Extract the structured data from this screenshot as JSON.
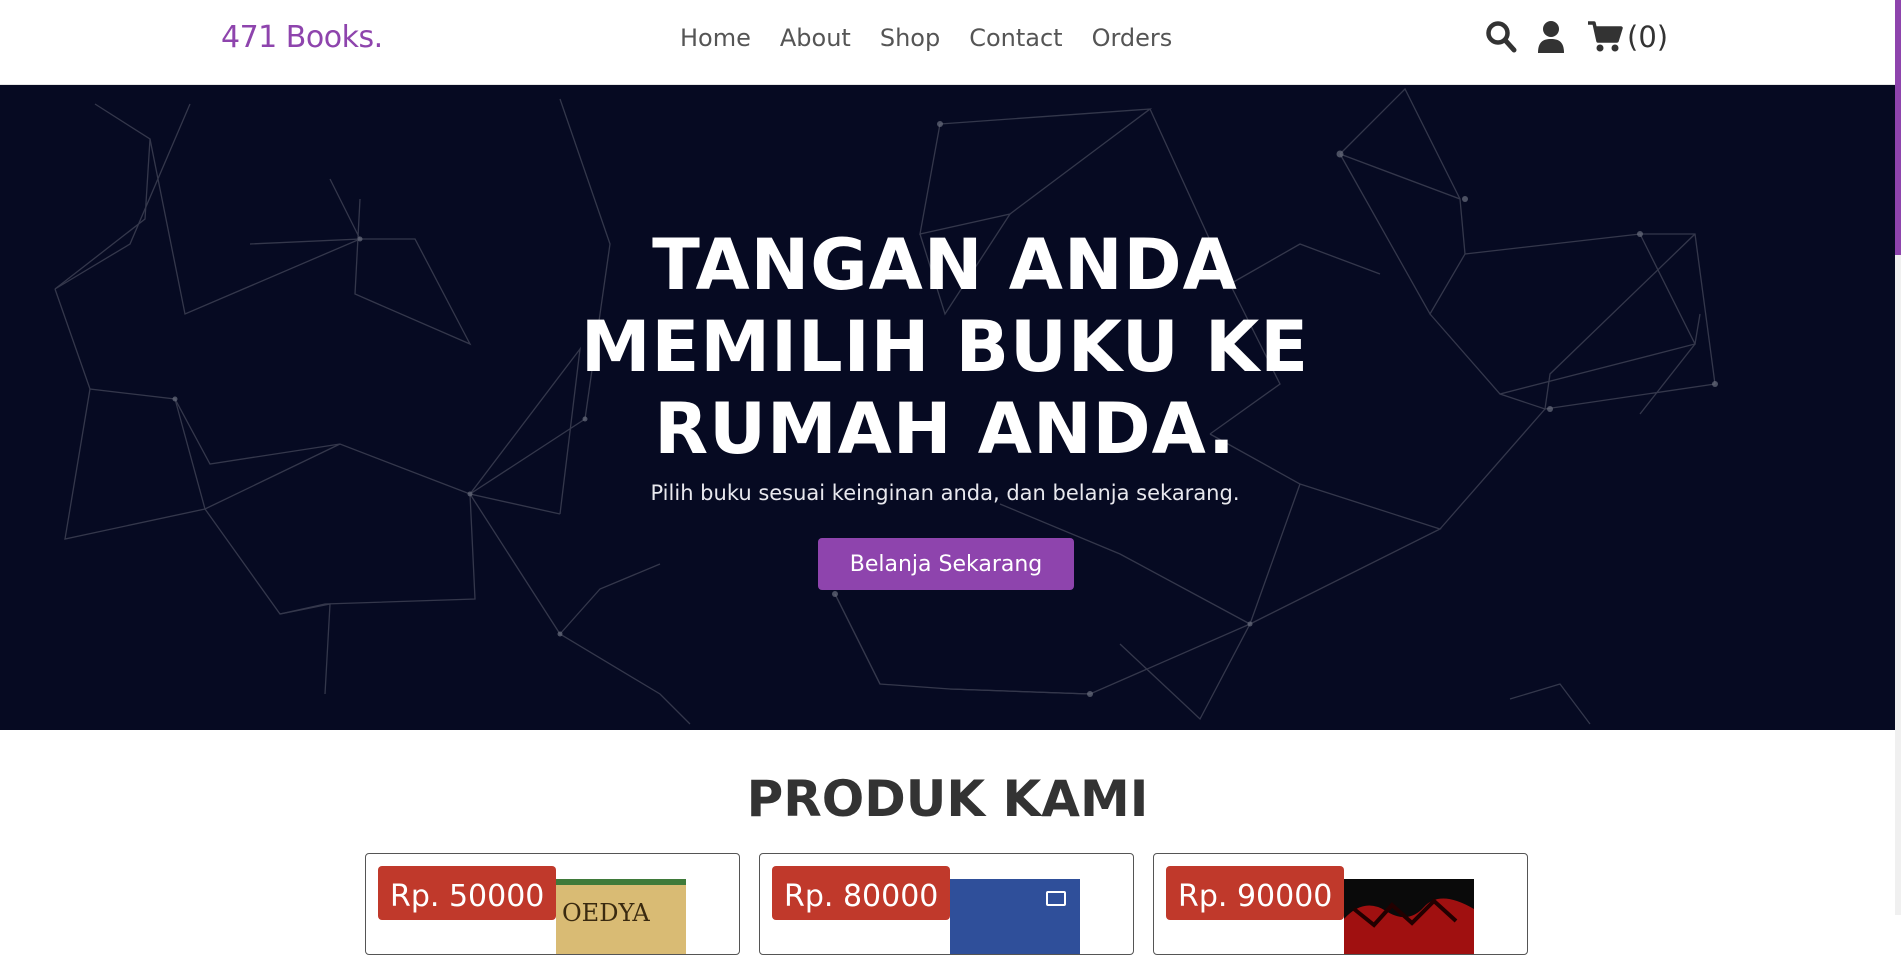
{
  "header": {
    "logo": "471 Books.",
    "nav": [
      "Home",
      "About",
      "Shop",
      "Contact",
      "Orders"
    ],
    "icons": [
      "search-icon",
      "user-icon",
      "cart-icon"
    ],
    "cart_count": "(0)"
  },
  "hero": {
    "title": "TANGAN ANDA MEMILIH BUKU KE RUMAH ANDA.",
    "subtitle": "Pilih buku sesuai keinginan anda, dan belanja sekarang.",
    "button": "Belanja Sekarang"
  },
  "products": {
    "title": "PRODUK KAMI",
    "items": [
      {
        "price": "Rp. 50000",
        "cover_text": "OEDYA",
        "cover_color": "#d9bb74"
      },
      {
        "price": "Rp. 80000",
        "cover_text": "",
        "cover_color": "#2f4f9a"
      },
      {
        "price": "Rp. 90000",
        "cover_text": "",
        "cover_color": "#0a0a0a"
      }
    ]
  },
  "colors": {
    "accent": "#8e44ad",
    "hero_bg": "#060a22",
    "price_badge": "#c0392b"
  }
}
